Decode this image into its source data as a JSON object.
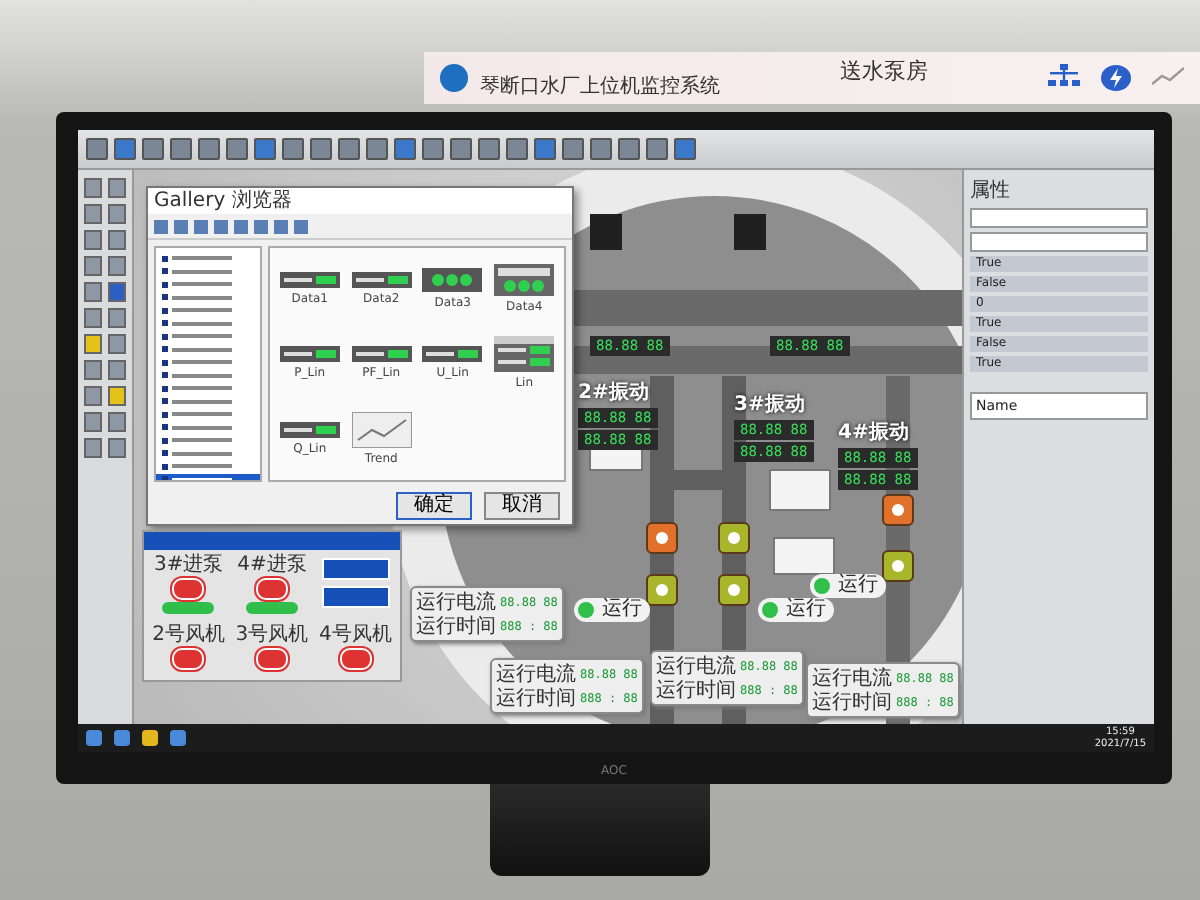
{
  "wall_display": {
    "system_title": "琴断口水厂上位机监控系统",
    "page_title": "送水泵房"
  },
  "dialog": {
    "title": "Gallery 浏览器",
    "tree_items": [
      {
        "selected": false
      },
      {
        "selected": false
      },
      {
        "selected": false
      },
      {
        "selected": false
      },
      {
        "selected": false
      },
      {
        "selected": false
      },
      {
        "selected": false
      },
      {
        "selected": false
      },
      {
        "selected": false
      },
      {
        "selected": false
      },
      {
        "selected": false
      },
      {
        "selected": false
      },
      {
        "selected": false
      },
      {
        "selected": false
      },
      {
        "selected": false
      },
      {
        "selected": false
      },
      {
        "selected": false
      },
      {
        "selected": true
      }
    ],
    "gallery": [
      {
        "label": "Data1",
        "kind": "meter"
      },
      {
        "label": "Data2",
        "kind": "meter"
      },
      {
        "label": "Data3",
        "kind": "lamps"
      },
      {
        "label": "Data4",
        "kind": "panel"
      },
      {
        "label": "P_Lin",
        "kind": "meter"
      },
      {
        "label": "PF_Lin",
        "kind": "meter"
      },
      {
        "label": "U_Lin",
        "kind": "meter"
      },
      {
        "label": "Lin",
        "kind": "dual"
      },
      {
        "label": "Q_Lin",
        "kind": "meter"
      },
      {
        "label": "Trend",
        "kind": "trend"
      }
    ],
    "buttons": [
      "确定",
      "取消"
    ]
  },
  "control_panel": {
    "pumps": [
      {
        "label": "3#进泵",
        "on": true
      },
      {
        "label": "4#进泵",
        "on": true
      }
    ],
    "fans": [
      {
        "label": "2号风机"
      },
      {
        "label": "3号风机"
      },
      {
        "label": "4号风机"
      }
    ]
  },
  "diagram": {
    "top_displays": [
      "88.88 88",
      "88.88 88"
    ],
    "vibration_groups": [
      {
        "label": "2#振动",
        "readings": [
          "88.88 88",
          "88.88 88"
        ]
      },
      {
        "label": "3#振动",
        "readings": [
          "88.88 88",
          "88.88 88"
        ]
      },
      {
        "label": "4#振动",
        "readings": [
          "88.88 88",
          "88.88 88"
        ]
      }
    ],
    "valves": [
      {
        "color": "#e0702a"
      },
      {
        "color": "#a9b52a"
      },
      {
        "color": "#e0702a"
      },
      {
        "color": "#a9b52a"
      },
      {
        "color": "#a9b52a"
      },
      {
        "color": "#a9b52a"
      }
    ],
    "status_pills": [
      {
        "label": "运行",
        "on": true
      },
      {
        "label": "运行",
        "on": true
      },
      {
        "label": "运行",
        "on": true
      }
    ],
    "readouts": [
      {
        "rows": [
          {
            "label": "运行电流",
            "value": "88.88 88"
          },
          {
            "label": "运行时间",
            "value": "888 : 88"
          }
        ]
      },
      {
        "rows": [
          {
            "label": "运行电流",
            "value": "88.88 88"
          },
          {
            "label": "运行时间",
            "value": "888 : 88"
          }
        ]
      },
      {
        "rows": [
          {
            "label": "运行电流",
            "value": "88.88 88"
          },
          {
            "label": "运行时间",
            "value": "888 : 88"
          }
        ]
      },
      {
        "rows": [
          {
            "label": "运行电流",
            "value": "88.88 88"
          },
          {
            "label": "运行时间",
            "value": "888 : 88"
          }
        ]
      }
    ]
  },
  "properties": {
    "title": "属性",
    "rows": [
      "True",
      "False",
      "0",
      "True",
      "False",
      "True"
    ],
    "name_label": "Name"
  },
  "taskbar": {
    "time": "15:59",
    "date": "2021/7/15"
  },
  "monitor": {
    "brand": "AOC"
  }
}
